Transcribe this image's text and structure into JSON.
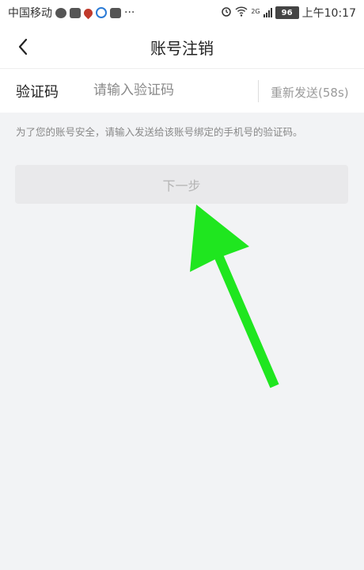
{
  "status_bar": {
    "carrier": "中国移动",
    "more": "···",
    "network": "2G",
    "battery": "96",
    "time": "上午10:17"
  },
  "header": {
    "title": "账号注销",
    "back_icon": "chevron-left-icon"
  },
  "verify": {
    "label": "验证码",
    "placeholder": "请输入验证码",
    "value": "",
    "resend_label": "重新发送(58s)"
  },
  "hint": "为了您的账号安全，请输入发送给该账号绑定的手机号的验证码。",
  "next_button": "下一步",
  "colors": {
    "arrow": "#1fe61f",
    "page_bg": "#f2f3f5",
    "button_bg": "#e9e9eb"
  }
}
